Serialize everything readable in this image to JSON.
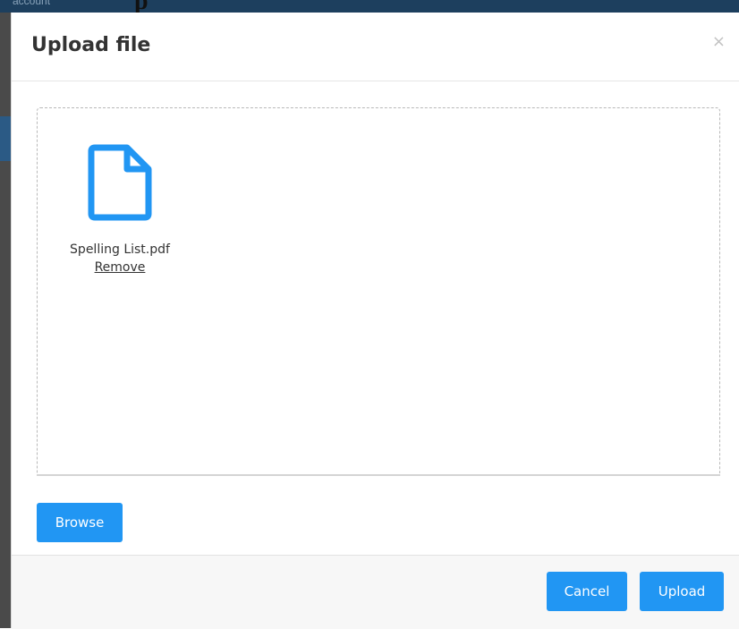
{
  "background": {
    "crumb": "account",
    "heading": "p"
  },
  "modal": {
    "title": "Upload file",
    "close_glyph": "×",
    "file": {
      "name": "Spelling List.pdf",
      "remove_label": "Remove",
      "icon": "document-icon"
    },
    "browse_label": "Browse",
    "footer": {
      "cancel_label": "Cancel",
      "upload_label": "Upload"
    }
  },
  "colors": {
    "accent": "#2196f3",
    "file_icon": "#2196f3"
  }
}
